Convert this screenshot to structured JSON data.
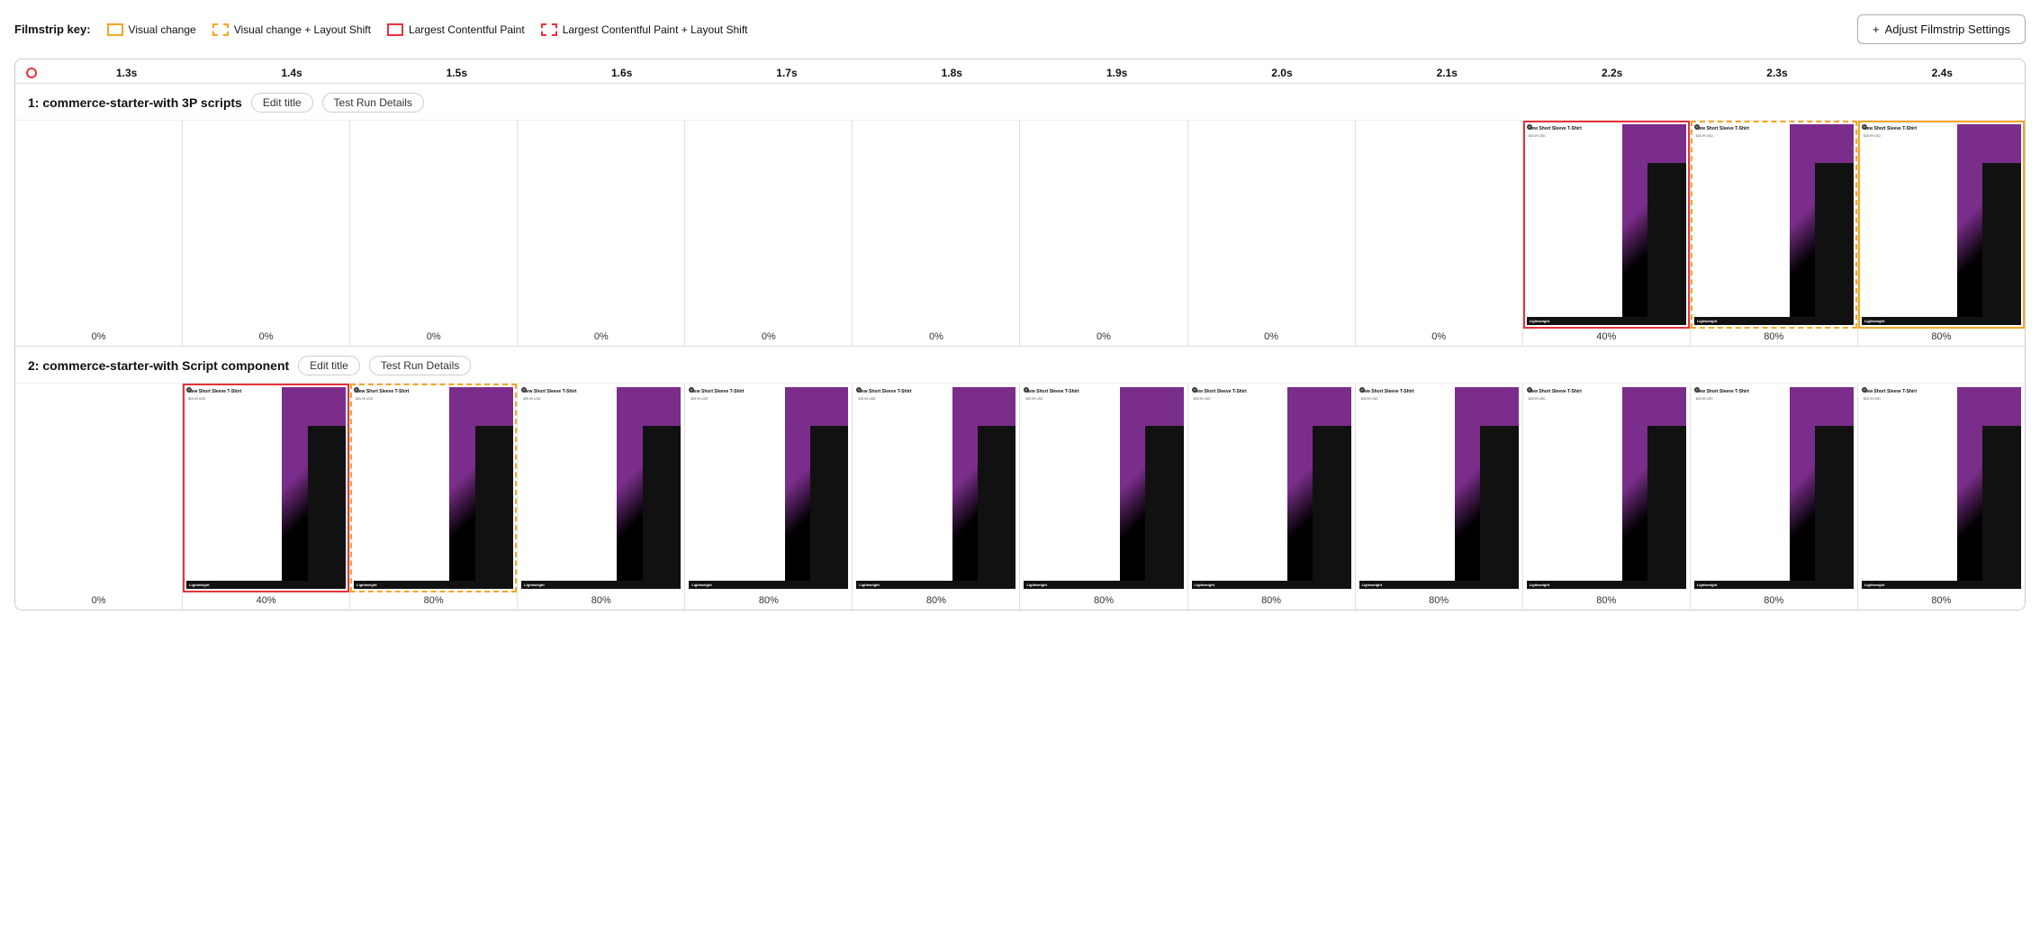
{
  "filmstrip_key": {
    "label": "Filmstrip key:",
    "items": [
      {
        "id": "visual-change",
        "label": "Visual change",
        "border_type": "solid-yellow"
      },
      {
        "id": "visual-change-layout-shift",
        "label": "Visual change + Layout Shift",
        "border_type": "dashed-yellow"
      },
      {
        "id": "lcp",
        "label": "Largest Contentful Paint",
        "border_type": "solid-red"
      },
      {
        "id": "lcp-layout-shift",
        "label": "Largest Contentful Paint + Layout Shift",
        "border_type": "dashed-red"
      }
    ]
  },
  "adjust_button": {
    "label": "Adjust Filmstrip Settings",
    "icon": "+"
  },
  "timeline": {
    "ticks": [
      "1.3s",
      "1.4s",
      "1.5s",
      "1.6s",
      "1.7s",
      "1.8s",
      "1.9s",
      "2.0s",
      "2.1s",
      "2.2s",
      "2.3s",
      "2.4s"
    ]
  },
  "rows": [
    {
      "id": "row1",
      "title": "1: commerce-starter-with 3P scripts",
      "edit_title_label": "Edit title",
      "test_run_label": "Test Run Details",
      "frames": [
        {
          "border": "none",
          "content": "blank",
          "percent": "0%"
        },
        {
          "border": "none",
          "content": "blank",
          "percent": "0%"
        },
        {
          "border": "none",
          "content": "blank",
          "percent": "0%"
        },
        {
          "border": "none",
          "content": "blank",
          "percent": "0%"
        },
        {
          "border": "none",
          "content": "blank",
          "percent": "0%"
        },
        {
          "border": "none",
          "content": "blank",
          "percent": "0%"
        },
        {
          "border": "none",
          "content": "blank",
          "percent": "0%"
        },
        {
          "border": "none",
          "content": "blank",
          "percent": "0%"
        },
        {
          "border": "none",
          "content": "blank",
          "percent": "0%"
        },
        {
          "border": "solid-red",
          "content": "product",
          "percent": "40%"
        },
        {
          "border": "dashed-yellow",
          "content": "product",
          "percent": "80%"
        },
        {
          "border": "solid-yellow",
          "content": "product",
          "percent": "80%"
        }
      ]
    },
    {
      "id": "row2",
      "title": "2: commerce-starter-with Script component",
      "edit_title_label": "Edit title",
      "test_run_label": "Test Run Details",
      "frames": [
        {
          "border": "none",
          "content": "blank",
          "percent": "0%"
        },
        {
          "border": "solid-red",
          "content": "product",
          "percent": "40%"
        },
        {
          "border": "dashed-yellow",
          "content": "product",
          "percent": "80%"
        },
        {
          "border": "none",
          "content": "product",
          "percent": "80%"
        },
        {
          "border": "none",
          "content": "product",
          "percent": "80%"
        },
        {
          "border": "none",
          "content": "product",
          "percent": "80%"
        },
        {
          "border": "none",
          "content": "product",
          "percent": "80%"
        },
        {
          "border": "none",
          "content": "product",
          "percent": "80%"
        },
        {
          "border": "none",
          "content": "product",
          "percent": "80%"
        },
        {
          "border": "none",
          "content": "product",
          "percent": "80%"
        },
        {
          "border": "none",
          "content": "product",
          "percent": "80%"
        },
        {
          "border": "none",
          "content": "product",
          "percent": "80%"
        }
      ]
    }
  ]
}
